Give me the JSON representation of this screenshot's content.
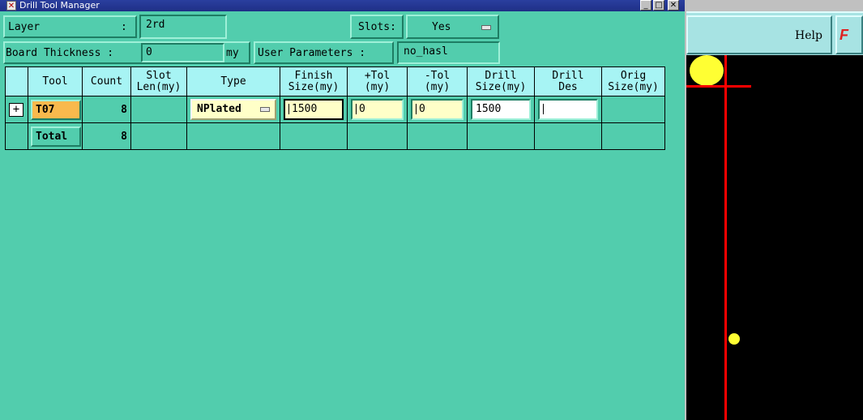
{
  "window": {
    "title": "Drill Tool Manager",
    "buttons": {
      "minimize": "_",
      "maximize": "□",
      "close": "✕"
    }
  },
  "top_row": {
    "layer_label": "Layer",
    "layer_colon": ":",
    "layer_value": "2rd",
    "slots_label": "Slots:",
    "slots_value": "Yes"
  },
  "second_row": {
    "thickness_label": "Board Thickness :",
    "thickness_value": "0",
    "thickness_unit": "my",
    "user_params_label": "User Parameters :",
    "user_params_value": "no_hasl"
  },
  "table": {
    "headers": [
      {
        "l1": "",
        "l2": ""
      },
      {
        "l1": "Tool",
        "l2": ""
      },
      {
        "l1": "Count",
        "l2": ""
      },
      {
        "l1": "Slot",
        "l2": "Len(my)"
      },
      {
        "l1": "Type",
        "l2": ""
      },
      {
        "l1": "Finish",
        "l2": "Size(my)"
      },
      {
        "l1": "+Tol",
        "l2": "(my)"
      },
      {
        "l1": "-Tol",
        "l2": "(my)"
      },
      {
        "l1": "Drill",
        "l2": "Size(my)"
      },
      {
        "l1": "Drill",
        "l2": "Des"
      },
      {
        "l1": "Orig",
        "l2": "Size(my)"
      }
    ],
    "rows": [
      {
        "tool": "T07",
        "count": "8",
        "slot_len": "",
        "type": "NPlated",
        "finish_size": "1500",
        "plus_tol": "0",
        "minus_tol": "0",
        "drill_size": "1500",
        "drill_des": "",
        "orig_size": ""
      }
    ],
    "total": {
      "label": "Total",
      "count": "8"
    }
  },
  "right_panel": {
    "help_label": "Help",
    "logo_text": "F"
  },
  "colors": {
    "window_bg": "#52cdad",
    "header_bg": "#a7f4f4",
    "tool_button": "#f9b94d",
    "input_bg": "#ffffc8",
    "title_bar": "#1f2f86",
    "canvas": "#000000",
    "canvas_line": "#ff0000",
    "canvas_pad": "#ffff33"
  }
}
